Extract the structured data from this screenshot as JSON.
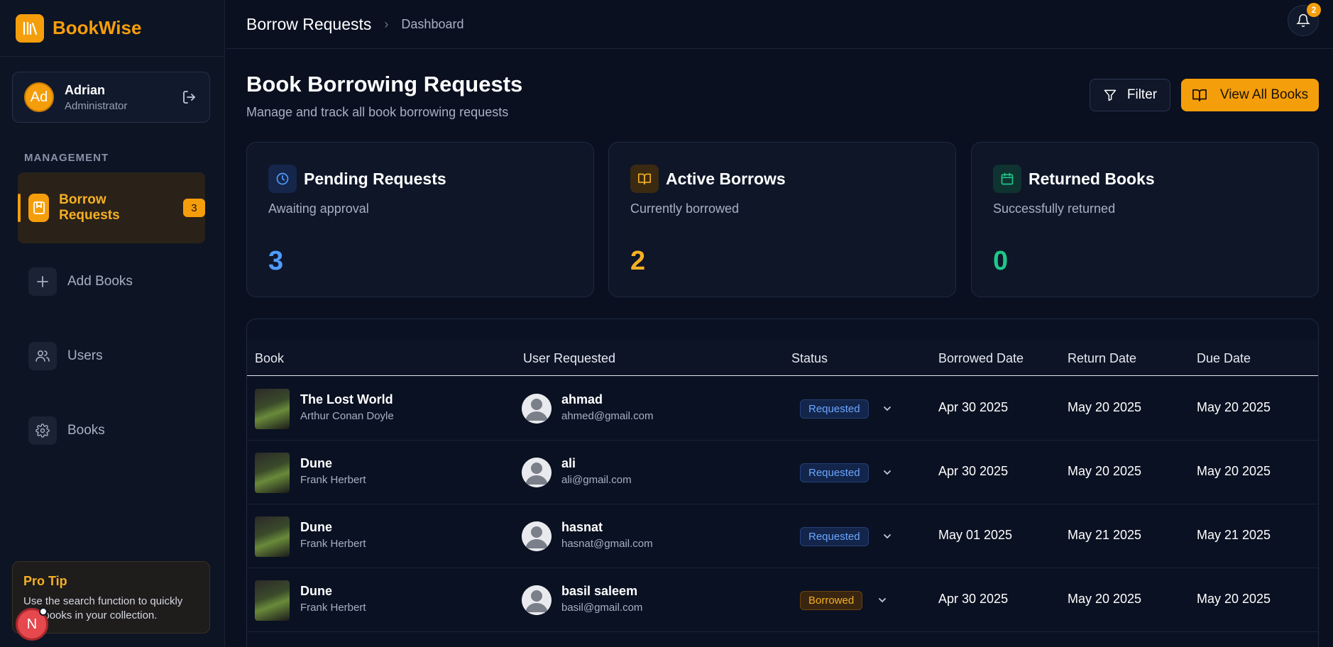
{
  "app": {
    "name": "BookWise"
  },
  "user": {
    "initials": "Ad",
    "name": "Adrian",
    "role": "Administrator"
  },
  "sidebar": {
    "section_label": "MANAGEMENT",
    "items": [
      {
        "label": "Borrow Requests",
        "icon": "bookmark-icon",
        "badge": "3",
        "active": true
      },
      {
        "label": "Add Books",
        "icon": "plus-icon"
      },
      {
        "label": "Users",
        "icon": "users-icon"
      },
      {
        "label": "Books",
        "icon": "gear-icon"
      }
    ],
    "pro_tip": {
      "title": "Pro Tip",
      "text": "Use the search function to quickly find books in your collection."
    },
    "n_badge": "N"
  },
  "topbar": {
    "breadcrumb_main": "Borrow Requests",
    "breadcrumb_sub": "Dashboard",
    "notifications": "2"
  },
  "header": {
    "title": "Book Borrowing Requests",
    "subtitle": "Manage and track all book borrowing requests",
    "filter_label": "Filter",
    "view_all_label": "View All Books"
  },
  "stats": [
    {
      "title": "Pending Requests",
      "desc": "Awaiting approval",
      "value": "3",
      "color": "#4f9bff",
      "icon": "clock-icon"
    },
    {
      "title": "Active Borrows",
      "desc": "Currently borrowed",
      "value": "2",
      "color": "#f5b025",
      "icon": "open-book-icon"
    },
    {
      "title": "Returned Books",
      "desc": "Successfully returned",
      "value": "0",
      "color": "#1fc78a",
      "icon": "calendar-icon"
    }
  ],
  "table": {
    "columns": [
      "Book",
      "User Requested",
      "Status",
      "Borrowed Date",
      "Return Date",
      "Due Date"
    ],
    "rows": [
      {
        "title": "The Lost World",
        "author": "Arthur Conan Doyle",
        "user": "ahmad",
        "email": "ahmed@gmail.com",
        "status": "Requested",
        "borrowed": "Apr 30 2025",
        "return": "May 20 2025",
        "due": "May 20 2025"
      },
      {
        "title": "Dune",
        "author": "Frank Herbert",
        "user": "ali",
        "email": "ali@gmail.com",
        "status": "Requested",
        "borrowed": "Apr 30 2025",
        "return": "May 20 2025",
        "due": "May 20 2025"
      },
      {
        "title": "Dune",
        "author": "Frank Herbert",
        "user": "hasnat",
        "email": "hasnat@gmail.com",
        "status": "Requested",
        "borrowed": "May 01 2025",
        "return": "May 21 2025",
        "due": "May 21 2025"
      },
      {
        "title": "Dune",
        "author": "Frank Herbert",
        "user": "basil saleem",
        "email": "basil@gmail.com",
        "status": "Borrowed",
        "borrowed": "Apr 30 2025",
        "return": "May 20 2025",
        "due": "May 20 2025"
      }
    ]
  }
}
